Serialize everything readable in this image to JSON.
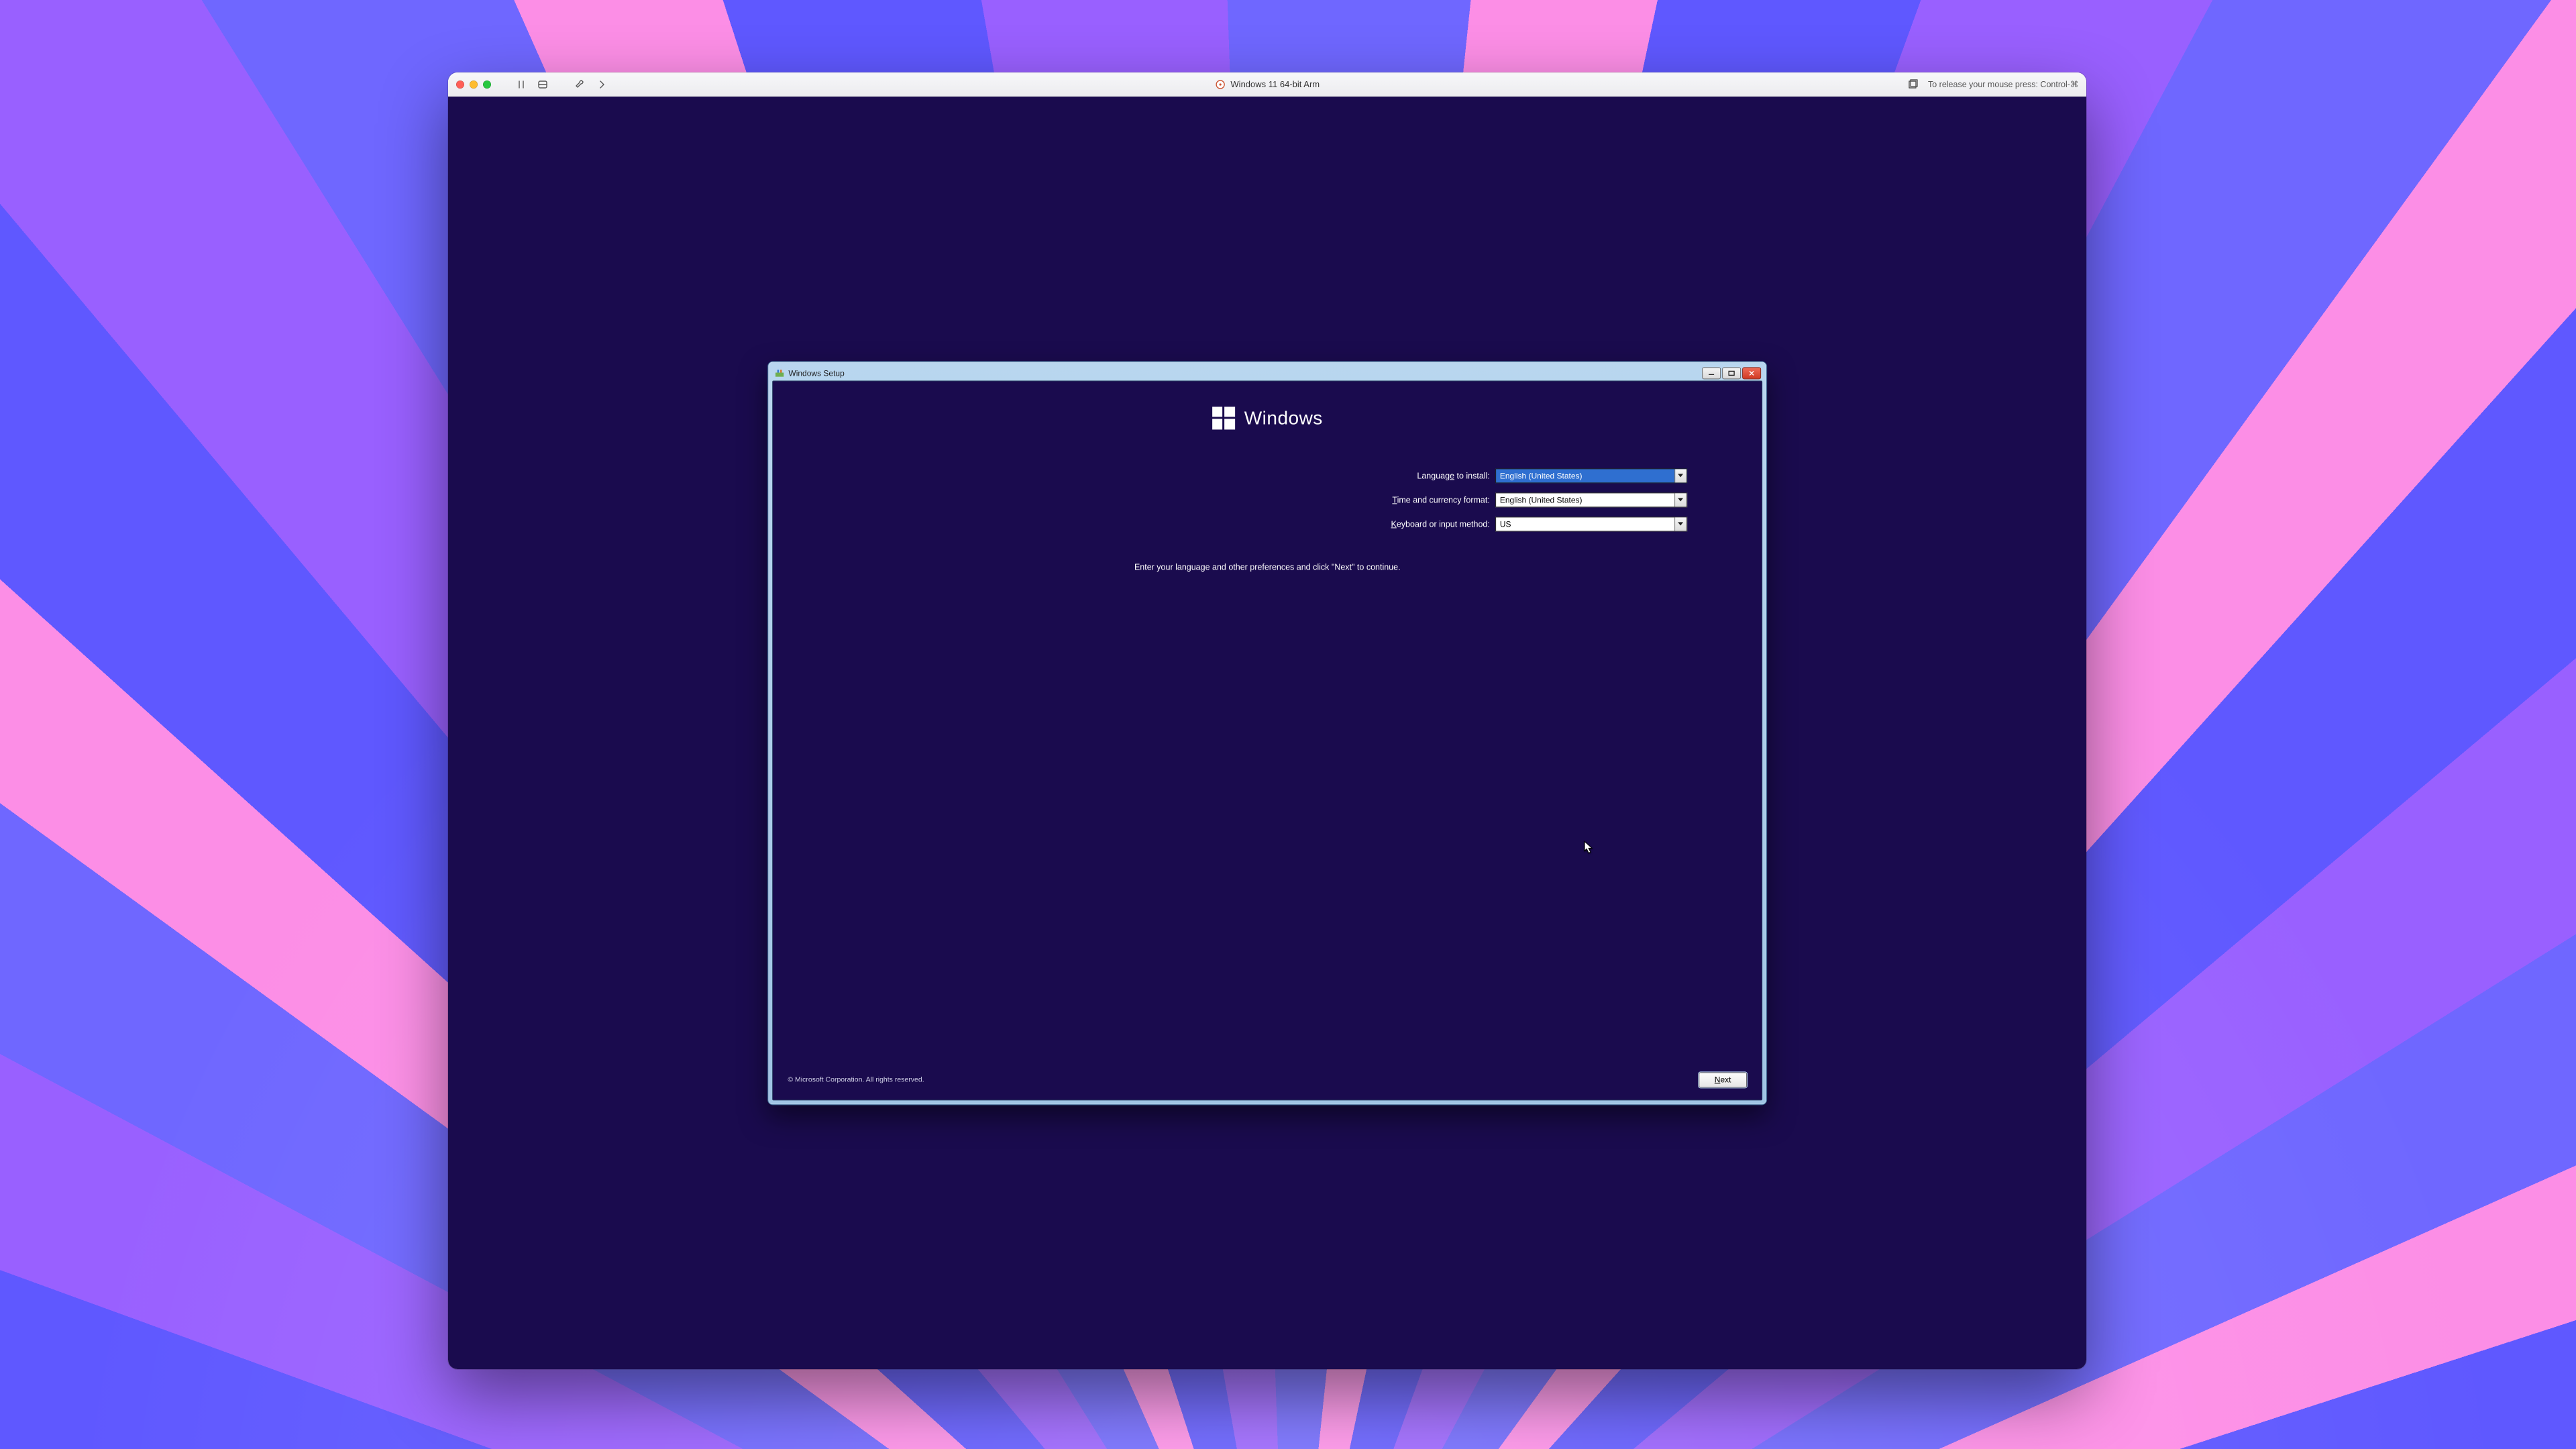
{
  "host": {
    "title": "Windows 11 64-bit Arm",
    "hint": "To release your mouse press: Control-⌘"
  },
  "setup": {
    "window_title": "Windows Setup",
    "brand": "Windows",
    "fields": {
      "language": {
        "label_pre": "Languag",
        "label_u": "e",
        "label_post": " to install:",
        "value": "English (United States)"
      },
      "time": {
        "label_u": "T",
        "label_post": "ime and currency format:",
        "value": "English (United States)"
      },
      "keyboard": {
        "label_u": "K",
        "label_post": "eyboard or input method:",
        "value": "US"
      }
    },
    "hint": "Enter your language and other preferences and click \"Next\" to continue.",
    "copyright": "© Microsoft Corporation. All rights reserved.",
    "next_u": "N",
    "next_rest": "ext"
  }
}
